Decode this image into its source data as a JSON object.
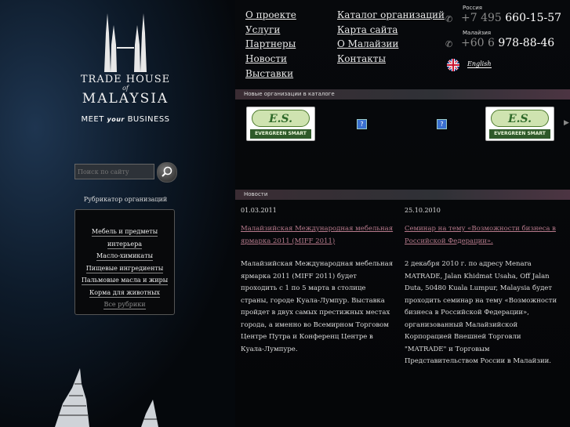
{
  "logo": {
    "line1": "TRADE HOUSE",
    "of": "of",
    "line2": "MALAYSIA",
    "slogan_pre": "MEET",
    "slogan_mid": "your",
    "slogan_post": "BUSINESS"
  },
  "search": {
    "placeholder": "Поиск по сайту"
  },
  "rubricator": {
    "title": "Рубрикатор организаций",
    "items": [
      "Мебель и предметы интерьера",
      "Масло-химикаты",
      "Пищевые ингредиенты",
      "Пальмовые масла и жиры",
      "Корма для животных"
    ],
    "all": "Все рубрики"
  },
  "nav": {
    "col1": [
      "О проекте",
      "Услуги",
      "Партнеры",
      "Новости",
      "Выставки"
    ],
    "col2": [
      "Каталог организаций",
      "Карта сайта",
      "О Малайзии",
      "Контакты"
    ]
  },
  "contacts": [
    {
      "country": "Россия",
      "prefix": "+7 495",
      "number": "660-15-57"
    },
    {
      "country": "Малайзия",
      "prefix": "+60 6",
      "number": "978-88-46"
    }
  ],
  "lang": {
    "label": "English"
  },
  "catalog": {
    "header": "Новые организации в каталоге",
    "logo_es": "E.S.",
    "logo_name": "EVERGREEN SMART",
    "placeholder_icon": "?"
  },
  "news": {
    "header": "Новости",
    "items": [
      {
        "date": "01.03.2011",
        "title": "Малайзийская Международная мебельная ярмарка 2011 (MIFF 2011)",
        "body": "Малайзийская Международная мебельная ярмарка 2011 (MIFF 2011) будет проходить с 1 по 5 марта в столице страны, городе Куала-Лумпур. Выставка пройдет в двух самых престижных местах города, а именно во Всемирном Торговом Центре Путра и Конференц Центре в Куала-Лумпуре."
      },
      {
        "date": "25.10.2010",
        "title": "Семинар на тему «Возможности бизнеса в Российской Федерации».",
        "body": "2 декабря 2010 г. по адресу Menara MATRADE, Jalan Khidmat Usaha, Off Jalan Duta, 50480 Kuala Lumpur, Malaysia будет проходить семинар на тему «Возможности бизнеса в Российской Федерации», организованный Малайзийской Корпорацией Внешней Торговли \"MATRADE\" и Торговым Представительством России в Малайзии."
      }
    ]
  },
  "colors": {
    "link_news": "#b77a8c",
    "accent_bar": "#3a2c33"
  }
}
